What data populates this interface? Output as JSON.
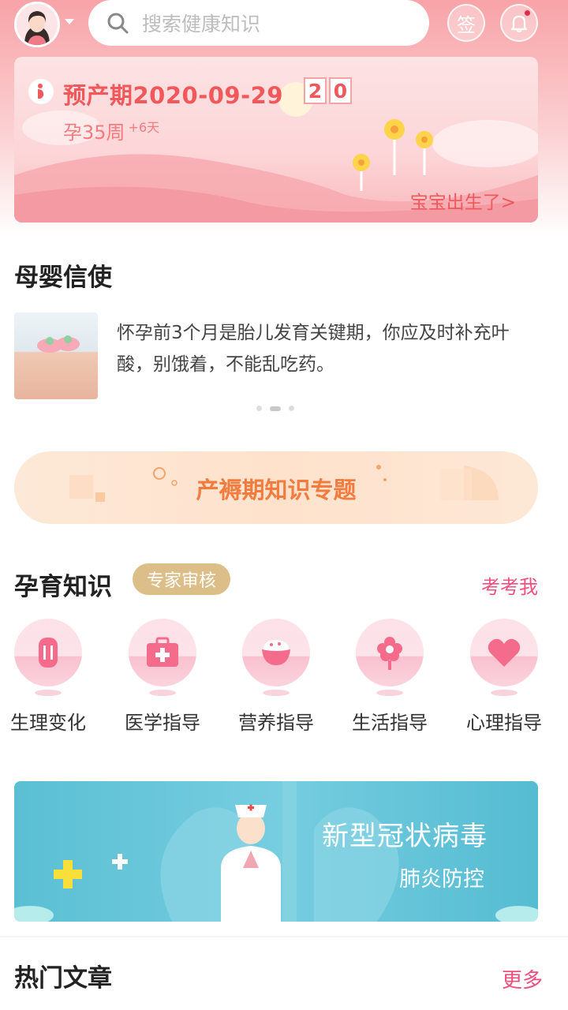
{
  "header": {
    "search_placeholder": "搜索健康知识",
    "sign_label": "签",
    "due_card": {
      "due_date_text": "预产期2020-09-29",
      "countdown_digits": [
        "2",
        "0"
      ],
      "week_text": "孕35周",
      "day_text": "+6天",
      "born_link": "宝宝出生了>"
    }
  },
  "messenger": {
    "title": "母婴信使",
    "text": "怀孕前3个月是胎儿发育关键期，你应及时补充叶酸，别饿着，不能乱吃药。"
  },
  "postpartum_banner": {
    "text": "产褥期知识专题"
  },
  "knowledge": {
    "title": "孕育知识",
    "badge": "专家审核",
    "quiz_link": "考考我",
    "categories": [
      {
        "label": "生理变化",
        "icon": "body-change-icon"
      },
      {
        "label": "医学指导",
        "icon": "medical-kit-icon"
      },
      {
        "label": "营养指导",
        "icon": "nutrition-bowl-icon"
      },
      {
        "label": "生活指导",
        "icon": "flower-icon"
      },
      {
        "label": "心理指导",
        "icon": "heart-icon"
      }
    ]
  },
  "virus_banner": {
    "title": "新型冠状病毒",
    "subtitle": "肺炎防控"
  },
  "hot_articles": {
    "title": "热门文章",
    "more_link": "更多"
  },
  "colors": {
    "brand_pink": "#f0585c",
    "link_pink": "#f0507e",
    "gold_badge": "#dcbe88",
    "orange": "#f27b3f"
  }
}
